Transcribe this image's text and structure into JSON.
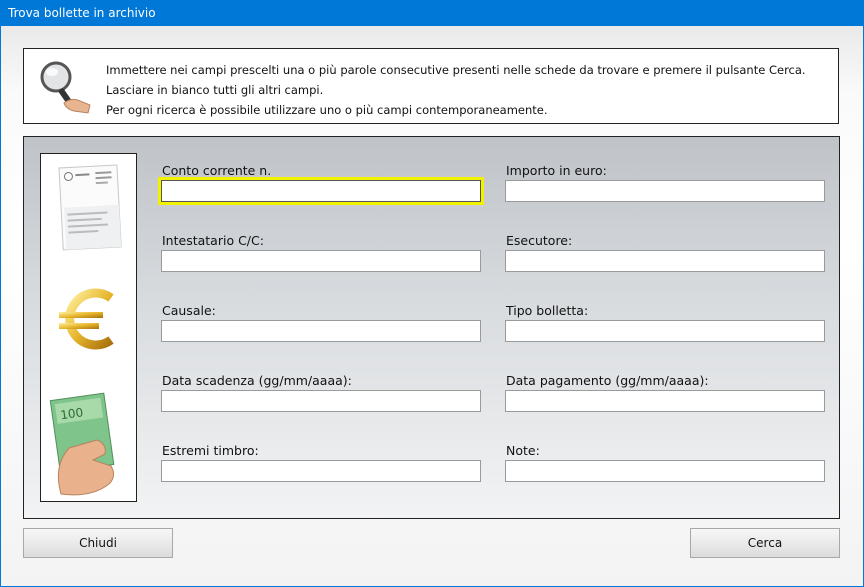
{
  "window": {
    "title": "Trova bollette in archivio"
  },
  "info": {
    "lines": [
      "Immettere nei campi prescelti una o più parole consecutive presenti nelle schede da trovare e premere il pulsante Cerca.",
      "Lasciare in bianco tutti gli altri campi.",
      "Per ogni ricerca è possibile utilizzare uno o più campi contemporaneamente."
    ]
  },
  "fields": {
    "conto_corrente": {
      "label": "Conto corrente n.",
      "value": ""
    },
    "importo": {
      "label": "Importo in euro:",
      "value": ""
    },
    "intestatario": {
      "label": "Intestatario C/C:",
      "value": ""
    },
    "esecutore": {
      "label": "Esecutore:",
      "value": ""
    },
    "causale": {
      "label": "Causale:",
      "value": ""
    },
    "tipo_bolletta": {
      "label": "Tipo bolletta:",
      "value": ""
    },
    "data_scadenza": {
      "label": "Data scadenza (gg/mm/aaaa):",
      "value": ""
    },
    "data_pagamento": {
      "label": "Data pagamento (gg/mm/aaaa):",
      "value": ""
    },
    "estremi_timbro": {
      "label": "Estremi timbro:",
      "value": ""
    },
    "note": {
      "label": "Note:",
      "value": ""
    }
  },
  "buttons": {
    "close": "Chiudi",
    "search": "Cerca"
  },
  "icons": [
    "magnifier-icon",
    "bill-receipt-icon",
    "euro-icon",
    "banknote-hand-icon"
  ],
  "colors": {
    "titlebar": "#0078d7",
    "focus_border": "#f2f200"
  }
}
